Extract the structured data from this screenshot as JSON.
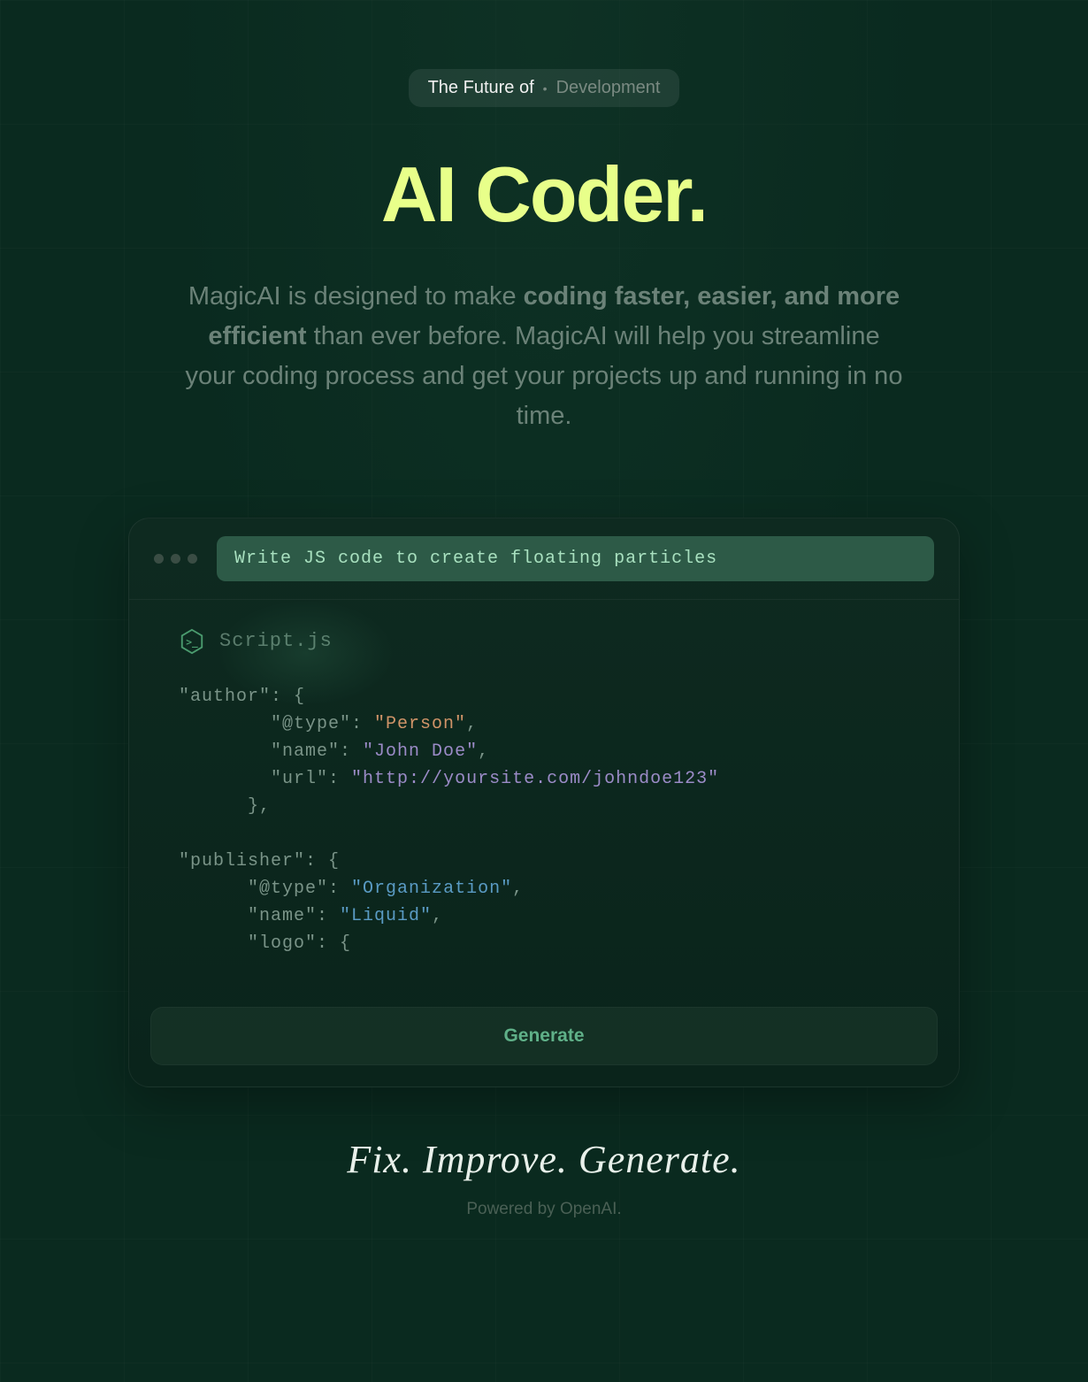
{
  "badge": {
    "primary": "The Future of",
    "secondary": "Development"
  },
  "hero": {
    "title": "AI Coder.",
    "desc_pre": "MagicAI is designed to make ",
    "desc_bold": "coding faster, easier, and more efficient",
    "desc_post": " than ever before. MagicAI will help you streamline your coding process and get your projects up and running in no time."
  },
  "window": {
    "prompt": "Write JS code to create floating particles",
    "filename": "Script.js",
    "code": {
      "author_key": "\"author\"",
      "type_key": "\"@type\"",
      "person": "\"Person\"",
      "name_key": "\"name\"",
      "john": "\"John Doe\"",
      "url_key": "\"url\"",
      "url_val": "\"http://yoursite.com/johndoe123\"",
      "publisher_key": "\"publisher\"",
      "org": "\"Organization\"",
      "liquid": "\"Liquid\"",
      "logo_key": "\"logo\""
    },
    "generate_label": "Generate"
  },
  "footer": {
    "tagline": "Fix. Improve. Generate.",
    "powered": "Powered by OpenAI."
  }
}
